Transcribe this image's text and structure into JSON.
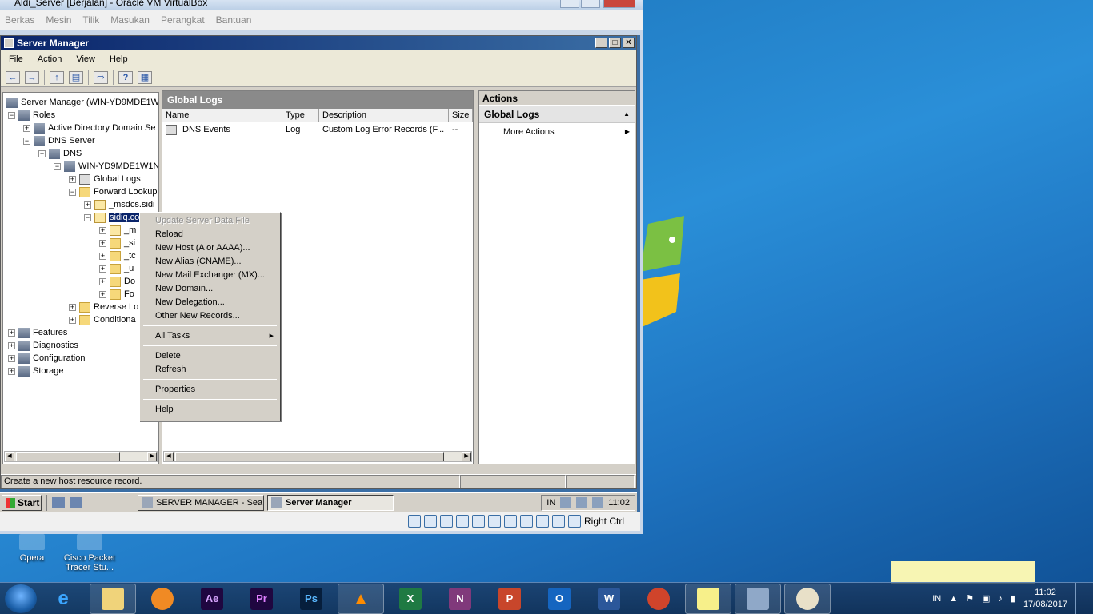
{
  "vbox": {
    "title": "Aldi_Server [Berjalan] - Oracle VM VirtualBox",
    "menu": [
      "Berkas",
      "Mesin",
      "Tilik",
      "Masukan",
      "Perangkat",
      "Bantuan"
    ],
    "host_key": "Right Ctrl"
  },
  "server_manager": {
    "title": "Server Manager",
    "menu": [
      "File",
      "Action",
      "View",
      "Help"
    ],
    "tree": {
      "root": "Server Manager (WIN-YD9MDE1W1",
      "roles": "Roles",
      "ad_domain": "Active Directory Domain Se",
      "dns_server": "DNS Server",
      "dns": "DNS",
      "host": "WIN-YD9MDE1W1N",
      "global_logs": "Global Logs",
      "forward_lookup": "Forward Lookup",
      "msdcs": "_msdcs.sidi",
      "sidiq": "sidiq.co",
      "sub1": "_m",
      "sub2": "_si",
      "sub3": "_tc",
      "sub4": "_u",
      "sub5": "Do",
      "sub6": "Fo",
      "reverse_lookup": "Reverse Lo",
      "conditional": "Conditiona",
      "features": "Features",
      "diagnostics": "Diagnostics",
      "configuration": "Configuration",
      "storage": "Storage"
    },
    "center": {
      "header": "Global Logs",
      "columns": [
        "Name",
        "Type",
        "Description",
        "Size"
      ],
      "rows": [
        {
          "name": "DNS Events",
          "type": "Log",
          "description": "Custom Log Error Records (F...",
          "size": "--"
        }
      ]
    },
    "actions": {
      "header": "Actions",
      "section": "Global Logs",
      "item": "More Actions"
    },
    "status": "Create a new host resource record."
  },
  "context_menu": {
    "update": "Update Server Data File",
    "reload": "Reload",
    "new_host": "New Host (A or AAAA)...",
    "new_alias": "New Alias (CNAME)...",
    "new_mx": "New Mail Exchanger (MX)...",
    "new_domain": "New Domain...",
    "new_delegation": "New Delegation...",
    "other_records": "Other New Records...",
    "all_tasks": "All Tasks",
    "delete": "Delete",
    "refresh": "Refresh",
    "properties": "Properties",
    "help": "Help"
  },
  "guest_taskbar": {
    "start": "Start",
    "task1": "SERVER MANAGER - Sea...",
    "task2": "Server Manager",
    "lang": "IN",
    "time": "11:02"
  },
  "desktop": {
    "icon1": "Opera",
    "icon2": "Cisco Packet Tracer Stu..."
  },
  "host_taskbar": {
    "lang": "IN",
    "time": "11:02",
    "date": "17/08/2017",
    "pins": [
      "Ae",
      "Pr",
      "Ps",
      "X",
      "N",
      "P",
      "O",
      "W"
    ]
  }
}
